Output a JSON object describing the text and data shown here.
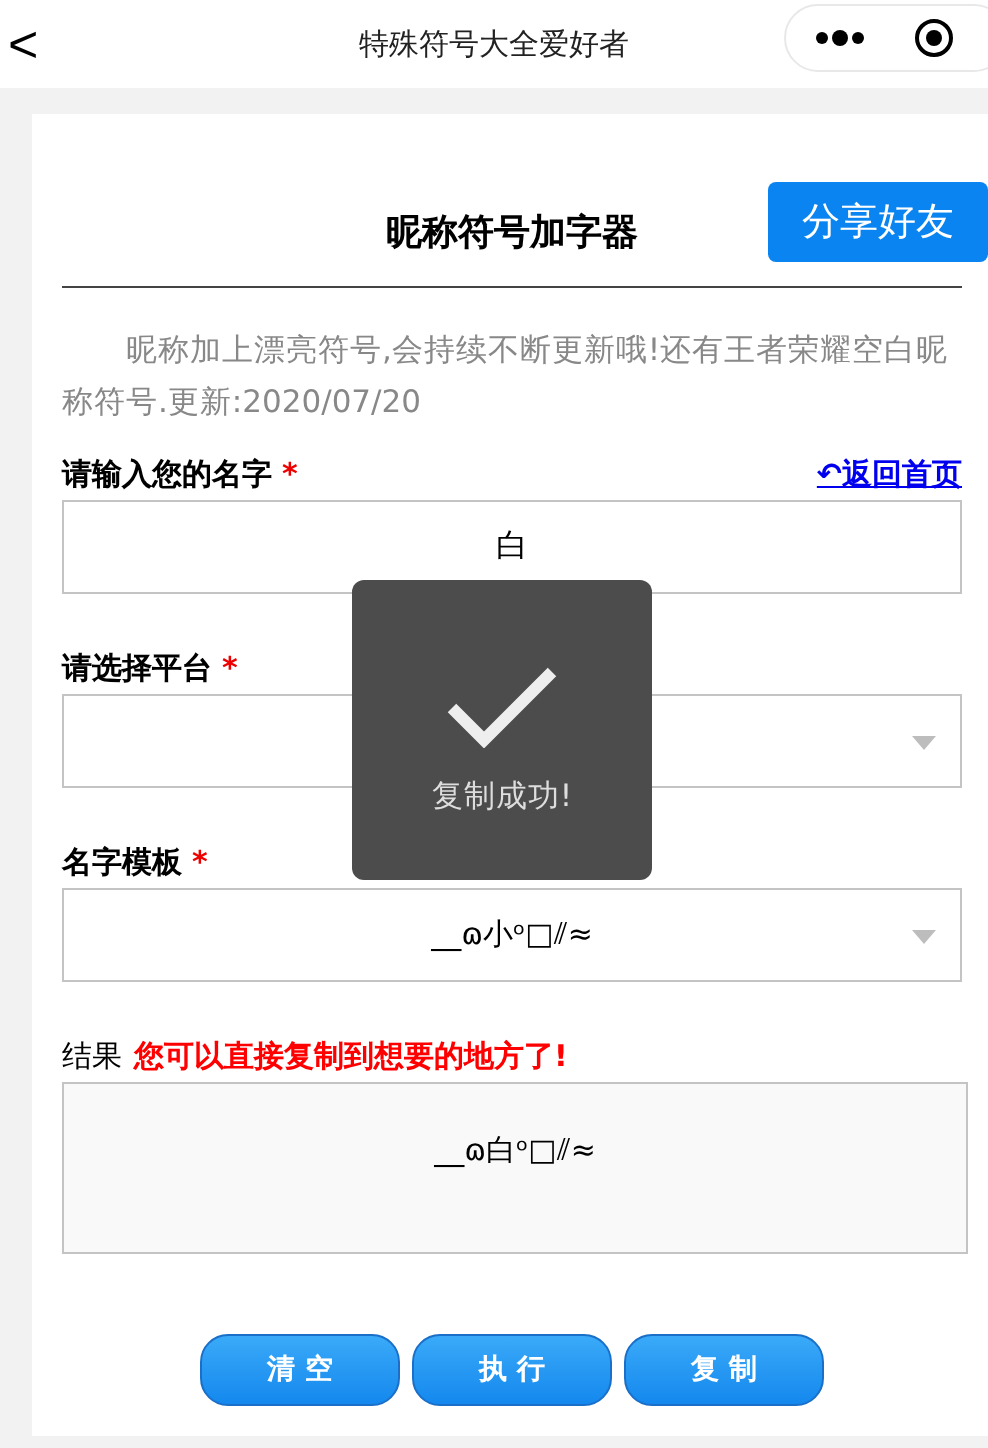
{
  "nav": {
    "back": "<",
    "title": "特殊符号大全爱好者"
  },
  "page": {
    "title": "昵称符号加字器",
    "share_button": "分享好友",
    "intro": "昵称加上漂亮符号,会持续不断更新哦!还有王者荣耀空白昵称符号.更新:2020/07/20",
    "home_link": "↶返回首页"
  },
  "fields": [
    {
      "kind": "input",
      "label": "请输入您的名字",
      "required_mark": "*",
      "value": "白"
    },
    {
      "kind": "select",
      "label": "请选择平台",
      "required_mark": "*"
    },
    {
      "kind": "select",
      "label": "名字模板",
      "required_mark": "*",
      "value": "__ɷ小ᵒ□⫽≈"
    }
  ],
  "result": {
    "label": "结果",
    "hint": "您可以直接复制到想要的地方了!",
    "value": "__ɷ白ᵒ□⫽≈"
  },
  "buttons": [
    "清 空",
    "执 行",
    "复 制"
  ],
  "toast": {
    "message": "复制成功!"
  }
}
